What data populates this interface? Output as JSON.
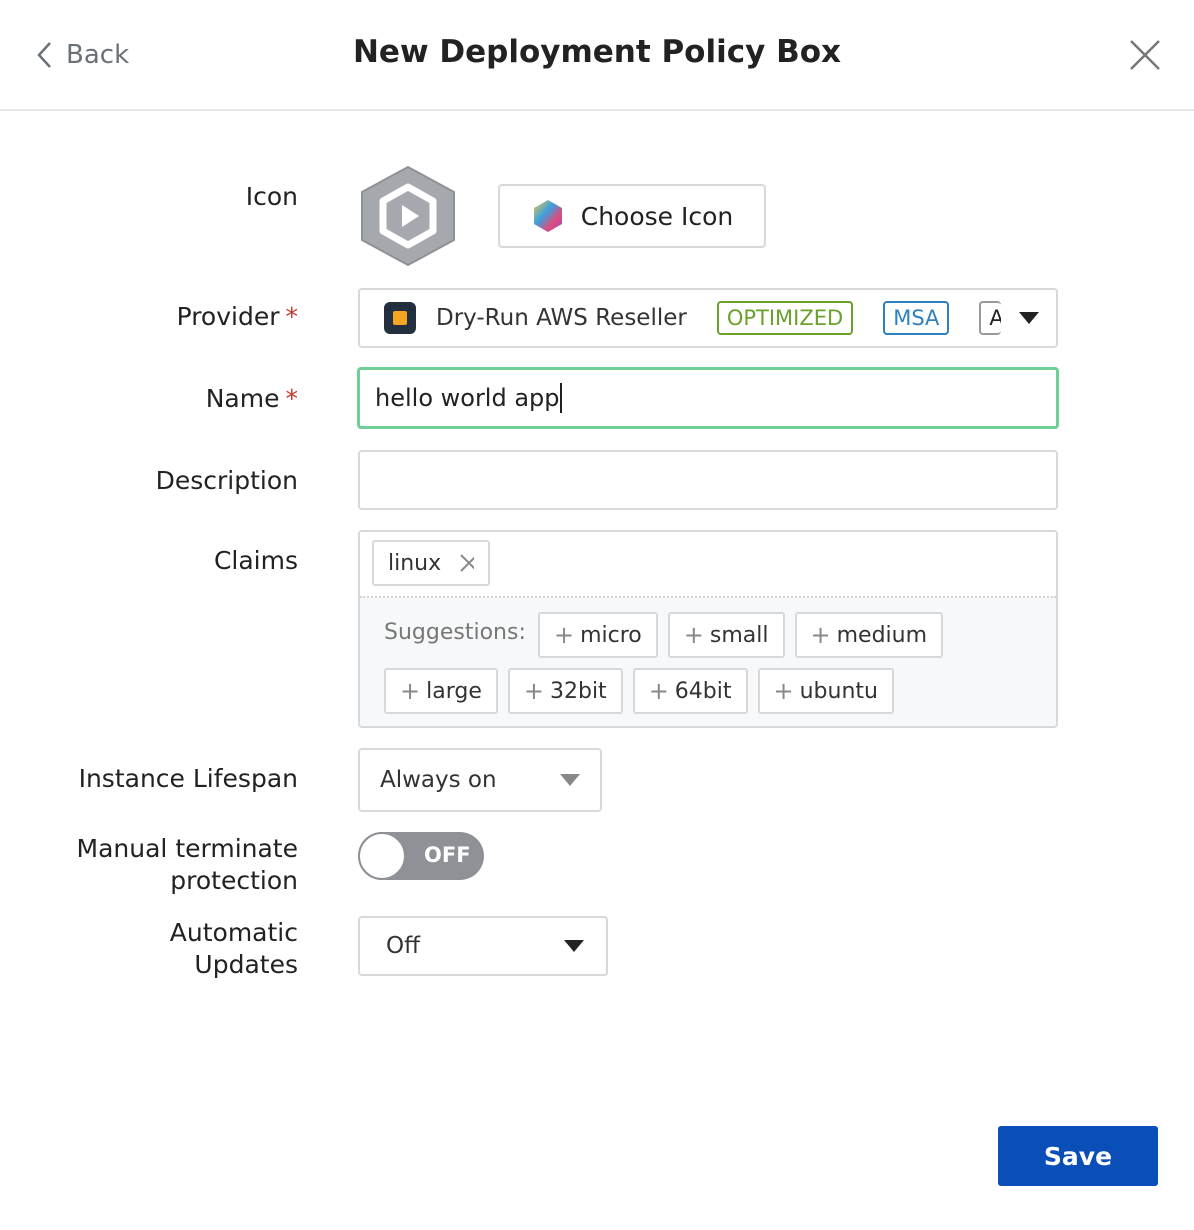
{
  "header": {
    "back_label": "Back",
    "title": "New Deployment Policy Box"
  },
  "form": {
    "icon_label": "Icon",
    "choose_icon_label": "Choose Icon",
    "provider_label": "Provider",
    "required_mark": "*",
    "provider_value": "Dry-Run AWS Reseller",
    "provider_badges": [
      "OPTIMIZED",
      "MSA",
      "A"
    ],
    "name_label": "Name",
    "name_value": "hello world app",
    "description_label": "Description",
    "description_value": "",
    "claims_label": "Claims",
    "claims": [
      "linux"
    ],
    "suggestions_label": "Suggestions:",
    "suggestions": [
      "micro",
      "small",
      "medium",
      "large",
      "32bit",
      "64bit",
      "ubuntu"
    ],
    "lifespan_label": "Instance Lifespan",
    "lifespan_value": "Always on",
    "terminate_label_1": "Manual terminate",
    "terminate_label_2": "protection",
    "terminate_toggle": "OFF",
    "updates_label_1": "Automatic",
    "updates_label_2": "Updates",
    "updates_value": "Off"
  },
  "save_label": "Save",
  "colors": {
    "accent": "#0a4fb8",
    "focus": "#6fcf97",
    "optimized": "#6aa12b",
    "msa": "#2f80c0"
  }
}
